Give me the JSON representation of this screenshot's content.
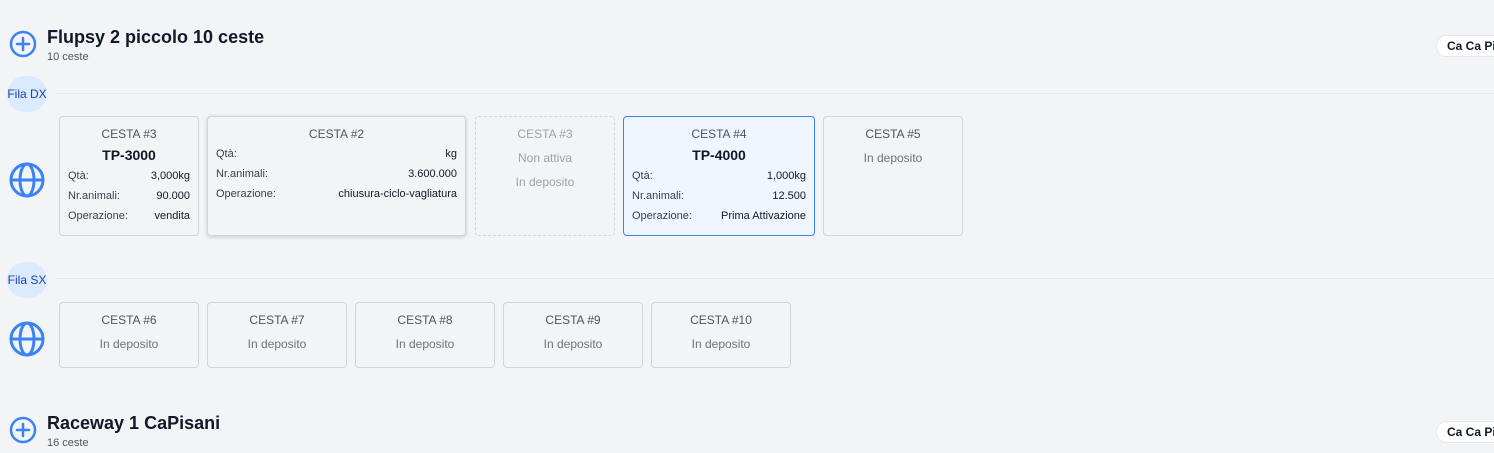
{
  "groups": [
    {
      "title": "Flupsy 2 piccolo 10 ceste",
      "subtitle": "10 ceste",
      "badge": "Ca Ca Pisani",
      "rows": [
        {
          "label": "Fila DX",
          "baskets": [
            {
              "title": "CESTA #3",
              "code": "TP-3000",
              "status": "",
              "fields": [
                {
                  "k": "Qtà:",
                  "v": "3,000kg"
                },
                {
                  "k": "Nr.animali:",
                  "v": "90.000"
                },
                {
                  "k": "Operazione:",
                  "v": "vendita"
                }
              ]
            },
            {
              "title": "CESTA #2",
              "code": "",
              "status": "",
              "fields": [
                {
                  "k": "Qtà:",
                  "v": "kg"
                },
                {
                  "k": "Nr.animali:",
                  "v": "3.600.000"
                },
                {
                  "k": "Operazione:",
                  "v": "chiusura-ciclo-vagliatura"
                }
              ]
            },
            {
              "title": "CESTA #3",
              "code": "",
              "status": "Non attiva",
              "status2": "In deposito",
              "fields": []
            },
            {
              "title": "CESTA #4",
              "code": "TP-4000",
              "status": "",
              "fields": [
                {
                  "k": "Qtà:",
                  "v": "1,000kg"
                },
                {
                  "k": "Nr.animali:",
                  "v": "12.500"
                },
                {
                  "k": "Operazione:",
                  "v": "Prima Attivazione"
                }
              ]
            },
            {
              "title": "CESTA #5",
              "code": "",
              "status": "In deposito",
              "fields": []
            }
          ]
        },
        {
          "label": "Fila SX",
          "baskets": [
            {
              "title": "CESTA #6",
              "status": "In deposito"
            },
            {
              "title": "CESTA #7",
              "status": "In deposito"
            },
            {
              "title": "CESTA #8",
              "status": "In deposito"
            },
            {
              "title": "CESTA #9",
              "status": "In deposito"
            },
            {
              "title": "CESTA #10",
              "status": "In deposito"
            }
          ]
        }
      ]
    },
    {
      "title": "Raceway 1 CaPisani",
      "subtitle": "16 ceste",
      "badge": "Ca Ca Pisani"
    }
  ],
  "colors": {
    "accent": "#3b82f6",
    "pill_bg": "#dbeafe",
    "pill_text": "#1e40af"
  },
  "icons": {
    "add": "plus-circle-icon",
    "globe": "globe-icon"
  }
}
